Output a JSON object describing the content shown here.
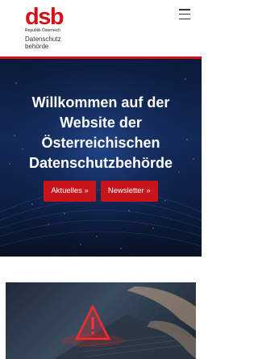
{
  "header": {
    "logo_mark": "dsb",
    "logo_subtitle": "Republik Österreich",
    "logo_name_line1": "Datenschutz",
    "logo_name_line2": "behörde",
    "menu_icon": "hamburger-menu-icon"
  },
  "hero": {
    "title": "Willkommen auf der Website der Österreichischen Datenschutzbehörde",
    "buttons": [
      {
        "label": "Aktuelles »"
      },
      {
        "label": "Newsletter »"
      }
    ]
  },
  "card": {
    "image": "laptop-warning-icon"
  },
  "colors": {
    "brand_red": "#d1121c",
    "hero_dark": "#0e1f44"
  }
}
